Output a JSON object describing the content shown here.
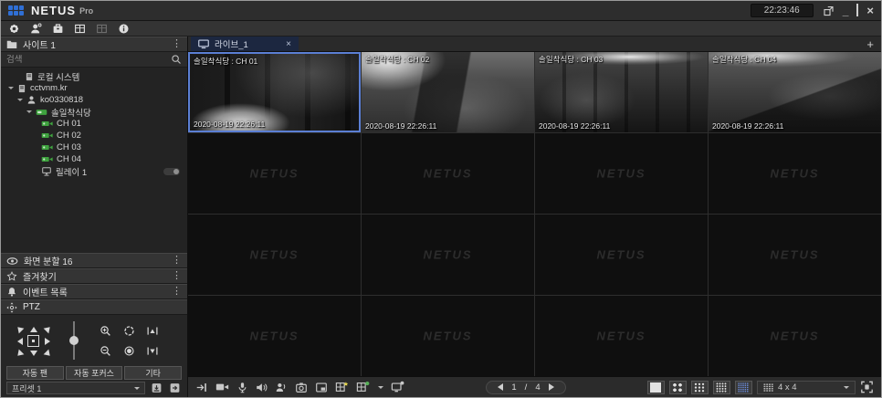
{
  "window": {
    "brand": "NETUS",
    "brand_suffix": "Pro",
    "clock": "22:23:46",
    "minimize_glyph": "_",
    "close_glyph": "×"
  },
  "sidebar": {
    "site_panel_title": "사이트 1",
    "kebab_glyph": "⋮",
    "search_placeholder": "검색",
    "tree": {
      "local_system": "로컬 시스템",
      "server": "cctvnm.kr",
      "account": "ko0330818",
      "device": "솔일착식당",
      "channels": [
        "CH 01",
        "CH 02",
        "CH 03",
        "CH 04"
      ],
      "relay": "릴레이 1"
    },
    "panels": {
      "split": "화면 분할 16",
      "favorites": "즐겨찾기",
      "events": "이벤트 목록",
      "ptz": "PTZ"
    },
    "ptz": {
      "auto_pan": "자동 팬",
      "auto_focus": "자동 포커스",
      "etc": "기타",
      "preset": "프리셋 1"
    }
  },
  "main": {
    "tab_label": "라이브_1",
    "tab_close": "×",
    "add_tab": "+",
    "watermark": "NETUS",
    "empty_tile_count": 12,
    "cameras": [
      {
        "title": "솔일착식당 : CH 01",
        "timestamp": "2020-08-19 22:26:11"
      },
      {
        "title": "솔일착식당 : CH 02",
        "timestamp": "2020-08-19 22:26:11"
      },
      {
        "title": "솔일착식당 : CH 03",
        "timestamp": "2020-08-19 22:26:11"
      },
      {
        "title": "솔일착식당 : CH 04",
        "timestamp": "2020-08-19 22:26:11"
      }
    ]
  },
  "bottom_toolbar": {
    "page_current": "1",
    "page_separator": "/",
    "page_total": "4",
    "layout_label": "4 x 4"
  },
  "colors": {
    "accent_blue": "#2f6fd6",
    "selected_tile_border": "#5b7fd4",
    "active_layout_blue": "#6b8cdd",
    "camera_green": "#4caf50",
    "tab_navy": "#1c2740"
  }
}
